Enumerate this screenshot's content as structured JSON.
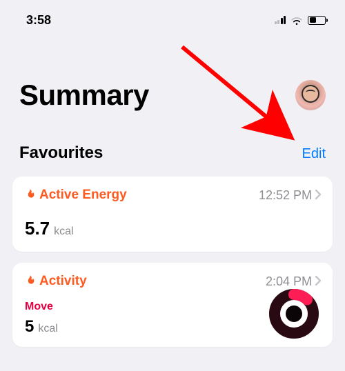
{
  "status": {
    "time": "3:58"
  },
  "header": {
    "title": "Summary"
  },
  "favourites": {
    "title": "Favourites",
    "edit": "Edit"
  },
  "cards": {
    "activeEnergy": {
      "icon": "flame-icon",
      "title": "Active Energy",
      "time": "12:52 PM",
      "value": "5.7",
      "unit": "kcal"
    },
    "activity": {
      "icon": "flame-icon",
      "title": "Activity",
      "time": "2:04 PM",
      "moveLabel": "Move",
      "value": "5",
      "unit": "kcal"
    }
  },
  "colors": {
    "accent_orange": "#ff5a1f",
    "accent_blue": "#007aff",
    "move_red": "#e30040"
  }
}
